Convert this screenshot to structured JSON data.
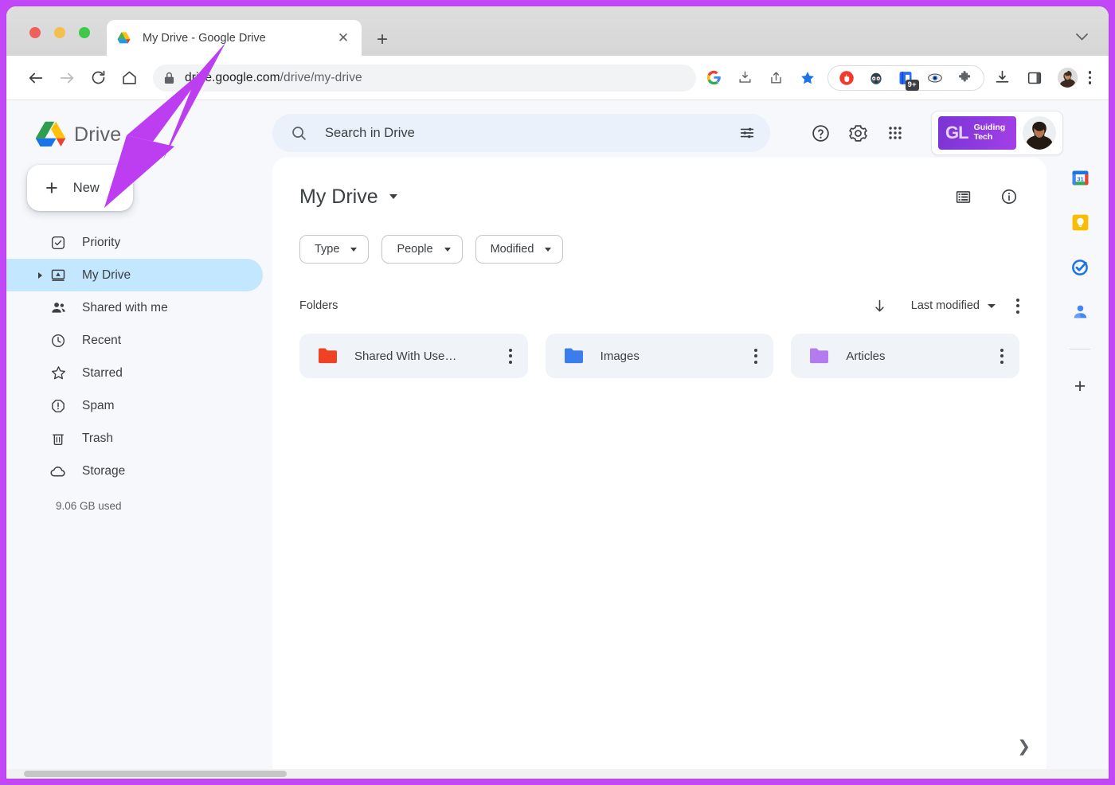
{
  "browser": {
    "tab": {
      "title": "My Drive - Google Drive",
      "favicon": "drive-favicon",
      "close_label": "✕"
    },
    "new_tab_label": "+",
    "tabstrip_chevron": "∨",
    "nav": {
      "back": "back-arrow",
      "forward": "forward-arrow",
      "reload": "reload",
      "home": "home"
    },
    "omnibox": {
      "lock": "lock-icon",
      "url_domain": "drive.google.com",
      "url_path": "/drive/my-drive",
      "full_url": "drive.google.com/drive/my-drive"
    },
    "omni_actions": [
      "google-g-icon",
      "install-icon",
      "share-icon",
      "bookmark-star-icon"
    ],
    "extensions": [
      {
        "name": "adblock-icon",
        "badge": ""
      },
      {
        "name": "privacy-badger-icon",
        "badge": ""
      },
      {
        "name": "notebook-extension-icon",
        "badge": "9+"
      },
      {
        "name": "eye-extension-icon",
        "badge": ""
      },
      {
        "name": "puzzle-extensions-icon",
        "badge": ""
      }
    ],
    "tail_icons": [
      "downloads-icon",
      "side-panel-icon",
      "profile-avatar"
    ],
    "menu": "chrome-menu-icon"
  },
  "drive": {
    "brand": {
      "logo": "google-drive-logo",
      "name": "Drive"
    },
    "new_button": {
      "label": "New",
      "icon": "plus-icon"
    },
    "sidebar": {
      "items": [
        {
          "label": "Priority",
          "icon": "check-circle-icon",
          "active": false
        },
        {
          "label": "My Drive",
          "icon": "my-drive-icon",
          "active": true
        },
        {
          "label": "Shared with me",
          "icon": "people-icon",
          "active": false
        },
        {
          "label": "Recent",
          "icon": "clock-icon",
          "active": false
        },
        {
          "label": "Starred",
          "icon": "star-icon",
          "active": false
        },
        {
          "label": "Spam",
          "icon": "exclamation-octagon-icon",
          "active": false
        },
        {
          "label": "Trash",
          "icon": "trash-icon",
          "active": false
        },
        {
          "label": "Storage",
          "icon": "cloud-icon",
          "active": false
        }
      ],
      "storage_used": "9.06 GB used"
    },
    "search": {
      "placeholder": "Search in Drive",
      "icon": "search-icon",
      "tune_icon": "tune-icon"
    },
    "top_actions": [
      {
        "name": "help-icon"
      },
      {
        "name": "settings-gear-icon"
      },
      {
        "name": "apps-grid-icon"
      }
    ],
    "account_chip": {
      "workspace_mark": "GL",
      "workspace_line1": "Guiding",
      "workspace_line2": "Tech",
      "avatar": "user-avatar"
    },
    "main": {
      "title": "My Drive",
      "title_caret": "chevron-down-icon",
      "view_toggle_icon": "list-view-icon",
      "info_icon": "info-icon",
      "filters": [
        {
          "label": "Type"
        },
        {
          "label": "People"
        },
        {
          "label": "Modified"
        }
      ],
      "section_title": "Folders",
      "sort": {
        "direction_icon": "arrow-down-icon",
        "label": "Last modified",
        "more_icon": "more-vertical-icon"
      },
      "folders": [
        {
          "name": "Shared With Use…",
          "color": "#ef4223"
        },
        {
          "name": "Images",
          "color": "#3b7ded"
        },
        {
          "name": "Articles",
          "color": "#b47bf0"
        }
      ],
      "expand_chevron": "❯"
    },
    "side_rail": [
      {
        "name": "google-calendar-icon"
      },
      {
        "name": "google-keep-icon"
      },
      {
        "name": "google-tasks-icon"
      },
      {
        "name": "google-contacts-icon"
      },
      {
        "name": "add-app-plus-icon"
      }
    ]
  },
  "annotation": {
    "arrow_color": "#bd3ef0",
    "border_color": "#c248f7",
    "points_to": "New"
  }
}
